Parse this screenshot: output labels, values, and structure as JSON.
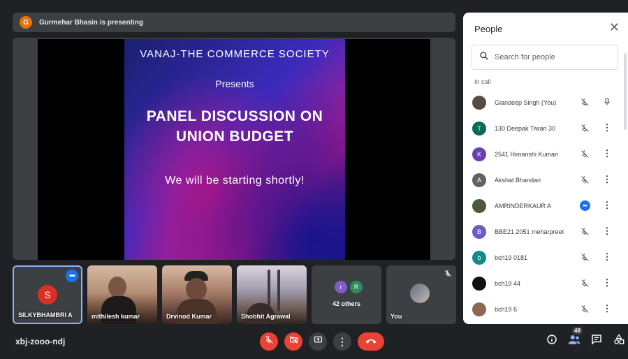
{
  "presenter": {
    "avatar_letter": "G",
    "text": "Gurmehar Bhasin is presenting"
  },
  "slide": {
    "title": "VANAJ-THE COMMERCE SOCIETY",
    "presents": "Presents",
    "heading_line1": "PANEL DISCUSSION ON",
    "heading_line2": "UNION BUDGET",
    "footer": "We will be starting shortly!"
  },
  "tiles": [
    {
      "name": "SILKYBHAMBRI A",
      "avatar_letter": "S",
      "selected": true
    },
    {
      "name": "mithilesh kumar"
    },
    {
      "name": "Drvinod Kumar"
    },
    {
      "name": "Shobhit Agrawal"
    },
    {
      "label": "42 others",
      "circles": [
        "r",
        "R"
      ]
    },
    {
      "name": "You"
    }
  ],
  "people_panel": {
    "title": "People",
    "search_placeholder": "Search for people",
    "section_label": "In call",
    "people": [
      {
        "name": "Giandeep Singh (You)",
        "avatar": "",
        "color": "#5a4a42",
        "action": "pin"
      },
      {
        "name": "130 Deepak Tiwari 30",
        "avatar": "T",
        "color": "#0b6b56",
        "action": "more"
      },
      {
        "name": "2541 Himanshi Kumari",
        "avatar": "K",
        "color": "#6a3fb5",
        "action": "more"
      },
      {
        "name": "Akshat Bhandari",
        "avatar": "A",
        "color": "#5f6368",
        "action": "more"
      },
      {
        "name": "AMRINDERKAUR A",
        "avatar": "",
        "color": "#4a5b3a",
        "action": "more",
        "speaking": true
      },
      {
        "name": "BBE21.2051 meharpreet",
        "avatar": "B",
        "color": "#6f5ac9",
        "action": "more"
      },
      {
        "name": "bch19 0181",
        "avatar": "b",
        "color": "#128a8a",
        "action": "more"
      },
      {
        "name": "bch19 44",
        "avatar": "",
        "color": "#111111",
        "action": "more"
      },
      {
        "name": "bch19 6",
        "avatar": "",
        "color": "#8a6a55",
        "action": "more"
      }
    ]
  },
  "bottom_bar": {
    "meeting_code": "xbj-zooo-ndj",
    "people_count": "48"
  },
  "colors": {
    "accent": "#1a73e8",
    "danger": "#ea4335",
    "background": "#202124"
  }
}
